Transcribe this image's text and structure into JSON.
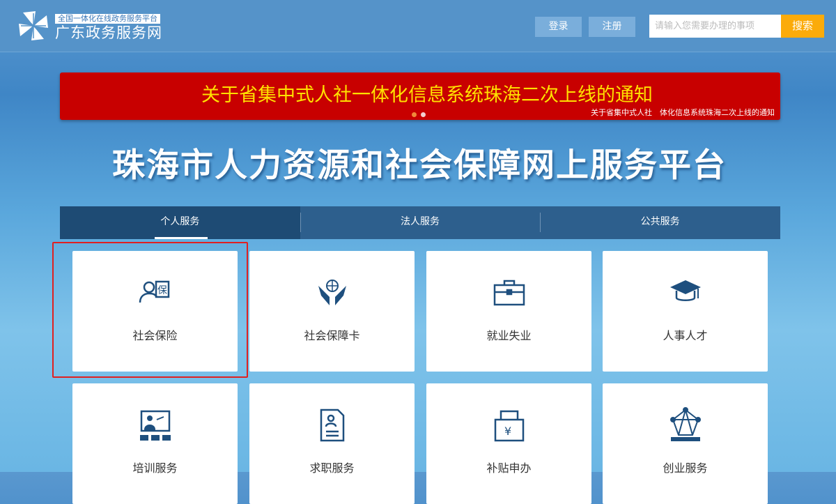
{
  "header": {
    "logo_sub": "全国一体化在线政务服务平台",
    "logo_main": "广东政务服务网",
    "login": "登录",
    "register": "注册",
    "search_placeholder": "请输入您需要办理的事项",
    "search_button": "搜索"
  },
  "banner": {
    "title": "关于省集中式人社一体化信息系统珠海二次上线的通知",
    "caption": "关于省集中式人社　体化信息系统珠海二次上线的通知"
  },
  "page_title": "珠海市人力资源和社会保障网上服务平台",
  "tabs": [
    {
      "label": "个人服务",
      "active": true
    },
    {
      "label": "法人服务"
    },
    {
      "label": "公共服务"
    }
  ],
  "cards": [
    {
      "label": "社会保险",
      "icon": "insurance-icon"
    },
    {
      "label": "社会保障卡",
      "icon": "globe-hands-icon"
    },
    {
      "label": "就业失业",
      "icon": "briefcase-icon"
    },
    {
      "label": "人事人才",
      "icon": "graduation-cap-icon"
    },
    {
      "label": "培训服务",
      "icon": "training-icon"
    },
    {
      "label": "求职服务",
      "icon": "resume-icon"
    },
    {
      "label": "补贴申办",
      "icon": "subsidy-icon"
    },
    {
      "label": "创业服务",
      "icon": "network-icon"
    }
  ],
  "colors": {
    "header": "#5593c9",
    "banner": "#c80000",
    "accent": "#fbab0a",
    "icon": "#1e4f7e"
  }
}
